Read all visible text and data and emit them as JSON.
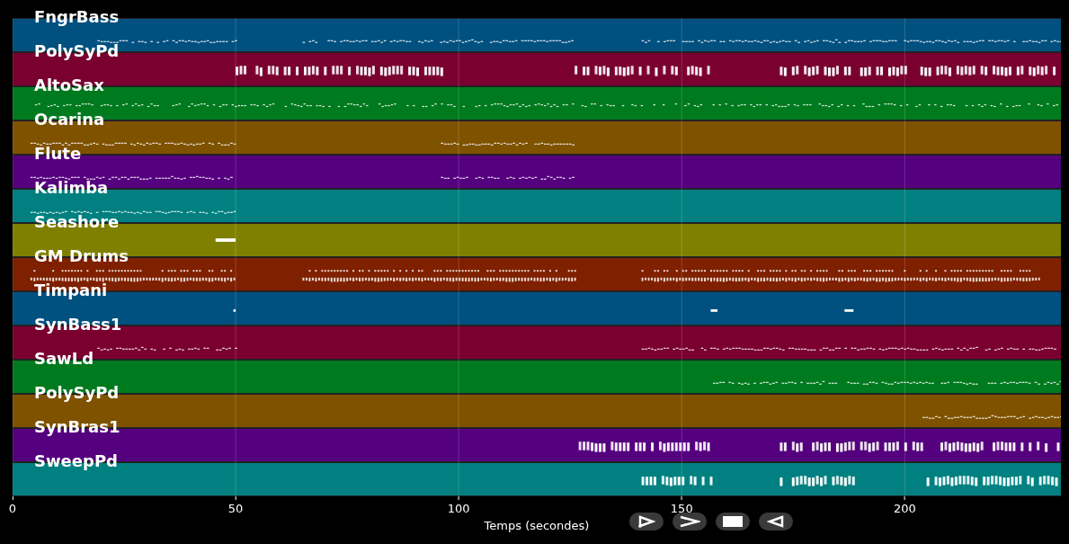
{
  "tracks": [
    {
      "name": "FngrBass",
      "color": "#005080"
    },
    {
      "name": "PolySyPd",
      "color": "#7a0030"
    },
    {
      "name": "AltoSax",
      "color": "#007a1e"
    },
    {
      "name": "Ocarina",
      "color": "#7f5200"
    },
    {
      "name": "Flute",
      "color": "#55007f"
    },
    {
      "name": "Kalimba",
      "color": "#008080"
    },
    {
      "name": "Seashore",
      "color": "#808000"
    },
    {
      "name": "GM Drums",
      "color": "#7f2000"
    },
    {
      "name": "Timpani",
      "color": "#005080"
    },
    {
      "name": "SynBass1",
      "color": "#7a0030"
    },
    {
      "name": "SawLd",
      "color": "#007a1e"
    },
    {
      "name": "PolySyPd",
      "color": "#7f5200"
    },
    {
      "name": "SynBras1",
      "color": "#55007f"
    },
    {
      "name": "SweepPd",
      "color": "#008080"
    }
  ],
  "x_axis": {
    "label": "Temps (secondes)",
    "ticks": [
      "0",
      "50",
      "100",
      "150",
      "200"
    ]
  },
  "controls": [
    {
      "kind": "play"
    },
    {
      "kind": "next"
    },
    {
      "kind": "stop"
    },
    {
      "kind": "back"
    }
  ]
}
